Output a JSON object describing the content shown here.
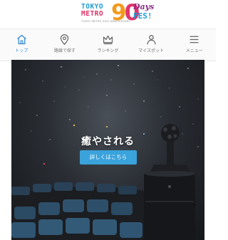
{
  "header": {
    "logo": {
      "metro_line1": "TOKYO",
      "metro_line2": "METRO",
      "subtitle": "TOKYO METRO 90th ANNIVERSARY",
      "digit_nine": "9",
      "digit_zero": "0",
      "days": "Days",
      "fes": "FES!"
    }
  },
  "nav": {
    "items": [
      {
        "label": "トップ",
        "icon": "home-icon",
        "active": true
      },
      {
        "label": "路線で探す",
        "icon": "map-pin-icon",
        "active": false
      },
      {
        "label": "ランキング",
        "icon": "crown-icon",
        "active": false
      },
      {
        "label": "マイスポット",
        "icon": "person-icon",
        "active": false
      },
      {
        "label": "メニュー",
        "icon": "hamburger-menu-icon",
        "active": false
      }
    ]
  },
  "hero": {
    "title": "癒やされる",
    "button_label": "詳しくはこちら"
  },
  "colors": {
    "accent_blue": "#3aa3dc",
    "nav_active": "#3d8fd1",
    "logo_orange": "#f39a1d",
    "logo_pink": "#e0346a"
  }
}
